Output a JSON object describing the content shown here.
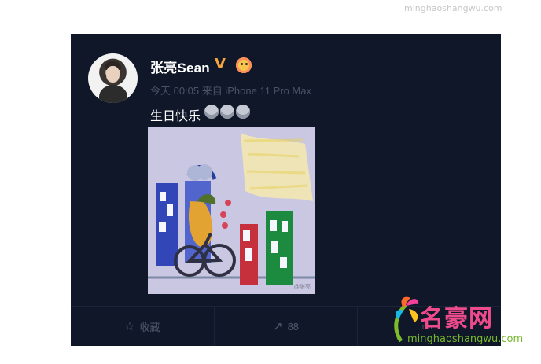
{
  "site_mark": "minghaoshangwu.com",
  "post": {
    "username": "张亮Sean",
    "verified_mark": "V",
    "meta": "今天 00:05 来自 iPhone 11 Pro Max",
    "text": "生日快乐",
    "drawing_watermark": "@张亮"
  },
  "actions": [
    {
      "label": "收藏",
      "icon": "star-icon"
    },
    {
      "label": "88",
      "icon": "share-icon"
    },
    {
      "label": "",
      "icon": "comment-icon"
    }
  ],
  "brand": {
    "name": "名豪网",
    "url": "minghaoshangwu.com"
  },
  "colors": {
    "card_bg": "#0f1729",
    "meta_text": "#495266",
    "verified": "#f6a43b",
    "brand_pink": "#ef4b8c",
    "brand_green": "#76b82a"
  }
}
